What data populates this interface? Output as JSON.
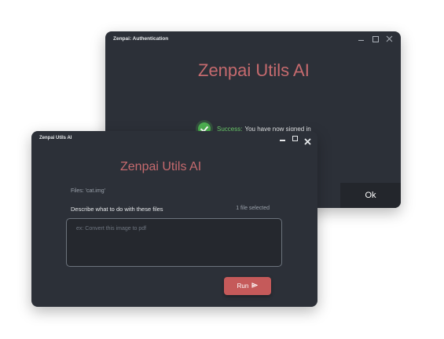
{
  "auth_window": {
    "title": "Zenpai: Authentication",
    "brand": "Zenpai Utils AI",
    "success_label": "Success:",
    "success_text": "You have now signed in",
    "ok_label": "Ok",
    "icons": [
      "minimize-icon",
      "maximize-icon",
      "close-icon",
      "success-check-icon"
    ]
  },
  "main_window": {
    "title": "Zenpai Utils AI",
    "brand": "Zenpai Utils AI",
    "files_label": "Files:",
    "files_value": "'cat.img'",
    "description_label": "Describe what to do with these files",
    "file_count": "1 file selected",
    "prompt_value": "",
    "prompt_placeholder": "ex: Convert this image to pdf",
    "run_label": "Run",
    "icons": [
      "minimize-icon",
      "maximize-icon",
      "close-icon",
      "send-icon"
    ]
  },
  "colors": {
    "window_bg": "#2c3038",
    "brand": "#c56a6e",
    "accent_button": "#c55a5a",
    "success": "#6fd06f"
  }
}
